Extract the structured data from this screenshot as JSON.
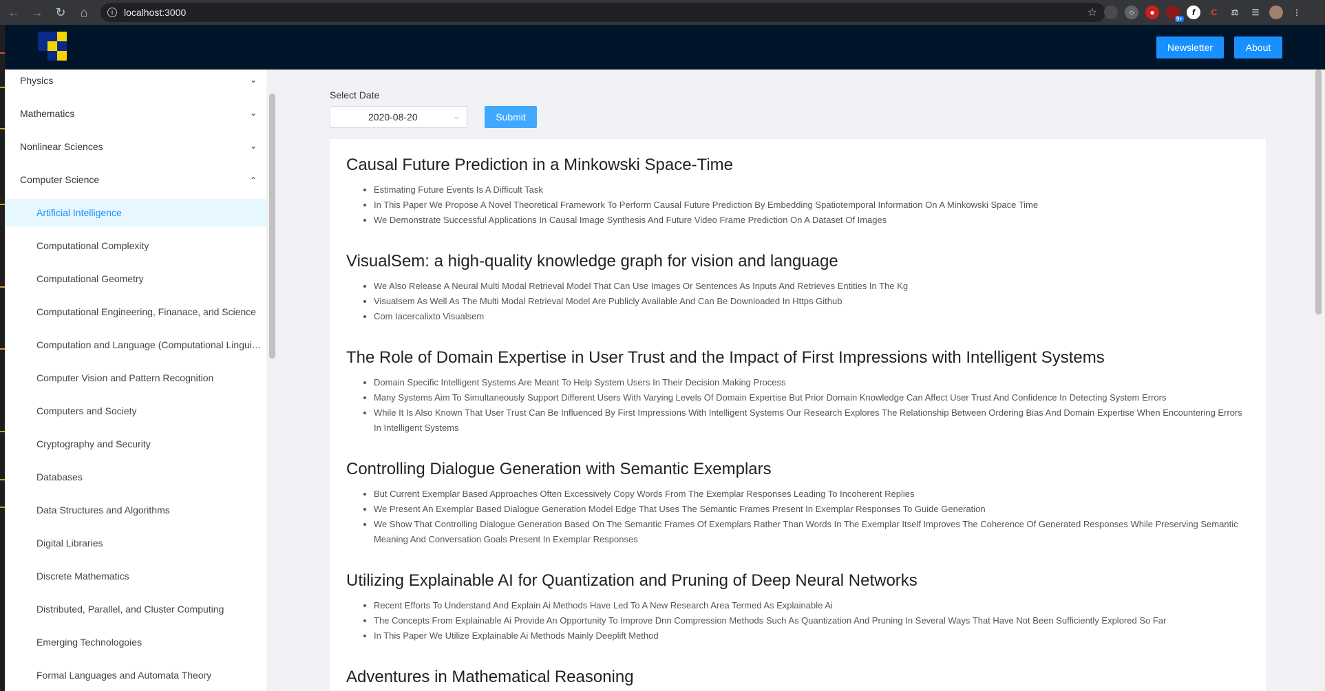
{
  "browser": {
    "url": "localhost:3000",
    "extension_badge": "9+"
  },
  "header": {
    "newsletter_label": "Newsletter",
    "about_label": "About"
  },
  "sidebar": {
    "top_items": [
      {
        "label": "Physics",
        "expanded": false
      },
      {
        "label": "Mathematics",
        "expanded": false
      },
      {
        "label": "Nonlinear Sciences",
        "expanded": false
      },
      {
        "label": "Computer Science",
        "expanded": true
      }
    ],
    "sub_items": [
      {
        "label": "Artificial Intelligence",
        "selected": true
      },
      {
        "label": "Computational Complexity"
      },
      {
        "label": "Computational Geometry"
      },
      {
        "label": "Computational Engineering, Finanace, and Science"
      },
      {
        "label": "Computation and Language (Computational Linguistics and Natural Language and Speech Processing)"
      },
      {
        "label": "Computer Vision and Pattern Recognition"
      },
      {
        "label": "Computers and Society"
      },
      {
        "label": "Cryptography and Security"
      },
      {
        "label": "Databases"
      },
      {
        "label": "Data Structures and Algorithms"
      },
      {
        "label": "Digital Libraries"
      },
      {
        "label": "Discrete Mathematics"
      },
      {
        "label": "Distributed, Parallel, and Cluster Computing"
      },
      {
        "label": "Emerging Technologoies"
      },
      {
        "label": "Formal Languages and Automata Theory"
      }
    ]
  },
  "controls": {
    "date_label": "Select Date",
    "date_value": "2020-08-20",
    "submit_label": "Submit"
  },
  "papers": [
    {
      "title": "Causal Future Prediction in a Minkowski Space-Time",
      "bullets": [
        "Estimating Future Events Is A Difficult Task",
        "In This Paper We Propose A Novel Theoretical Framework To Perform Causal Future Prediction By Embedding Spatiotemporal Information On A Minkowski Space Time",
        "We Demonstrate Successful Applications In Causal Image Synthesis And Future Video Frame Prediction On A Dataset Of Images"
      ]
    },
    {
      "title": "VisualSem: a high-quality knowledge graph for vision and language",
      "bullets": [
        "We Also Release A Neural Multi Modal Retrieval Model That Can Use Images Or Sentences As Inputs And Retrieves Entities In The Kg",
        "Visualsem As Well As The Multi Modal Retrieval Model Are Publicly Available And Can Be Downloaded In Https Github",
        "Com Iacercalixto Visualsem"
      ]
    },
    {
      "title": "The Role of Domain Expertise in User Trust and the Impact of First Impressions with Intelligent Systems",
      "bullets": [
        "Domain Specific Intelligent Systems Are Meant To Help System Users In Their Decision Making Process",
        "Many Systems Aim To Simultaneously Support Different Users With Varying Levels Of Domain Expertise But Prior Domain Knowledge Can Affect User Trust And Confidence In Detecting System Errors",
        "While It Is Also Known That User Trust Can Be Influenced By First Impressions With Intelligent Systems Our Research Explores The Relationship Between Ordering Bias And Domain Expertise When Encountering Errors In Intelligent Systems"
      ]
    },
    {
      "title": "Controlling Dialogue Generation with Semantic Exemplars",
      "bullets": [
        "But Current Exemplar Based Approaches Often Excessively Copy Words From The Exemplar Responses Leading To Incoherent Replies",
        "We Present An Exemplar Based Dialogue Generation Model Edge That Uses The Semantic Frames Present In Exemplar Responses To Guide Generation",
        "We Show That Controlling Dialogue Generation Based On The Semantic Frames Of Exemplars Rather Than Words In The Exemplar Itself Improves The Coherence Of Generated Responses While Preserving Semantic Meaning And Conversation Goals Present In Exemplar Responses"
      ]
    },
    {
      "title": "Utilizing Explainable AI for Quantization and Pruning of Deep Neural Networks",
      "bullets": [
        "Recent Efforts To Understand And Explain Ai Methods Have Led To A New Research Area Termed As Explainable Ai",
        "The Concepts From Explainable Ai Provide An Opportunity To Improve Dnn Compression Methods Such As Quantization And Pruning In Several Ways That Have Not Been Sufficiently Explored So Far",
        "In This Paper We Utilize Explainable Ai Methods Mainly Deeplift Method"
      ]
    },
    {
      "title": "Adventures in Mathematical Reasoning",
      "bullets": []
    }
  ],
  "colors": {
    "header_bg": "#001529",
    "accent": "#1890ff",
    "logo_blue": "#0a2a8a",
    "logo_yellow": "#f5d400"
  }
}
